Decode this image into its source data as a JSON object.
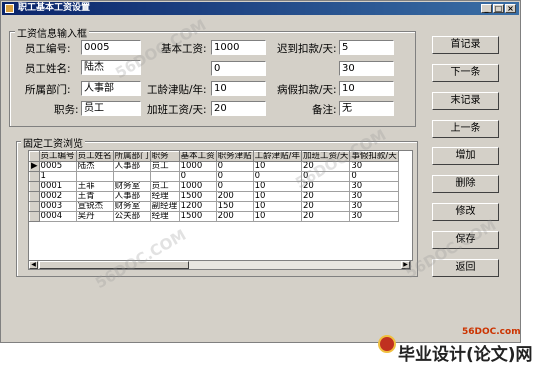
{
  "window": {
    "title": "职工基本工资设置"
  },
  "info_group": {
    "title": "工资信息输入框"
  },
  "fields": {
    "emp_no": {
      "label": "员工编号:",
      "value": "0005"
    },
    "emp_name": {
      "label": "员工姓名:",
      "value": "陆杰"
    },
    "department": {
      "label": "所属部门:",
      "value": "人事部"
    },
    "position": {
      "label": "职务:",
      "value": "员工"
    },
    "base_salary": {
      "label": "基本工资:",
      "value": "1000"
    },
    "blank_field": {
      "value": "0"
    },
    "seniority": {
      "label": "工龄津贴/年:",
      "value": "10"
    },
    "overtime": {
      "label": "加班工资/天:",
      "value": "20"
    },
    "late_deduct": {
      "label": "迟到扣款/天:",
      "value": "5"
    },
    "blank_field2": {
      "value": "30"
    },
    "sick_deduct": {
      "label": "病假扣款/天:",
      "value": "10"
    },
    "remark": {
      "label": "备注:",
      "value": "无"
    }
  },
  "grid_group": {
    "title": "固定工资浏览"
  },
  "grid": {
    "columns": [
      "员工编号",
      "员工姓名",
      "所属部门",
      "职务",
      "基本工资",
      "职务津贴",
      "工龄津贴/年",
      "加班工资/天",
      "事假扣款/天"
    ],
    "rows": [
      [
        "0005",
        "陆杰",
        "人事部",
        "员工",
        "1000",
        "0",
        "10",
        "20",
        "30"
      ],
      [
        "1",
        "",
        "",
        "",
        "0",
        "0",
        "0",
        "0",
        "0"
      ],
      [
        "0001",
        "王菲",
        "财务室",
        "员工",
        "1000",
        "0",
        "10",
        "20",
        "30"
      ],
      [
        "0002",
        "王青",
        "人事部",
        "经理",
        "1500",
        "200",
        "10",
        "20",
        "30"
      ],
      [
        "0003",
        "宣锐杰",
        "财务室",
        "副经理",
        "1200",
        "150",
        "10",
        "20",
        "30"
      ],
      [
        "0004",
        "吴丹",
        "公关部",
        "经理",
        "1500",
        "200",
        "10",
        "20",
        "30"
      ]
    ]
  },
  "buttons": {
    "first": "首记录",
    "next": "下一条",
    "last": "末记录",
    "prev": "上一条",
    "add": "增加",
    "delete": "删除",
    "modify": "修改",
    "save": "保存",
    "back": "返回"
  },
  "watermark": {
    "text": "56DOC.COM"
  },
  "footer": {
    "url": "56DOC.com",
    "brand": "毕业设计(论文)网"
  }
}
